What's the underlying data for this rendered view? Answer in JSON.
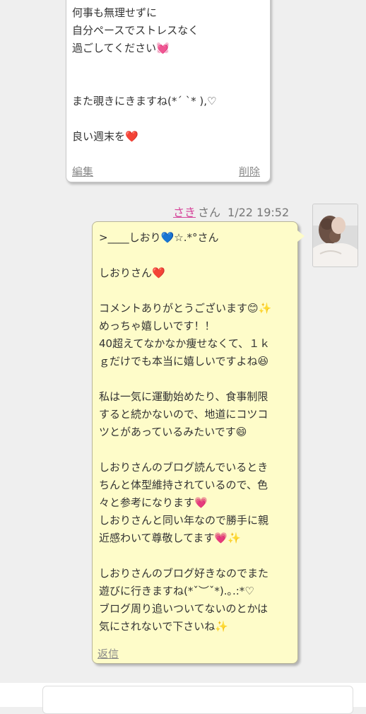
{
  "prev_comment": {
    "lines": [
      "何事も無理せずに",
      "自分ペースでストレスなく",
      "過ごしてください💓",
      "",
      "",
      "また覗きにきますね(*ˊ ˋ* ),♡",
      "",
      "良い週末を❤️"
    ],
    "edit_label": "編集",
    "delete_label": "削除"
  },
  "reply": {
    "author": "さき",
    "honorific": "さん",
    "timestamp": "1/22 19:52",
    "lines": [
      ">____しおり💙☆.*°さん",
      "",
      "しおりさん❤️",
      "",
      "コメントありがとうございます😊✨",
      "めっちゃ嬉しいです！！",
      "40超えてなかなか痩せなくて、１ｋ",
      "ｇだけでも本当に嬉しいですよね😆",
      "",
      "私は一気に運動始めたり、食事制限",
      "すると続かないので、地道にコツコ",
      "ツとがあっているみたいです😄",
      "",
      "しおりさんのブログ読んでいるとき",
      "ちんと体型維持されているので、色",
      "々と参考になります💗",
      "しおりさんと同い年なので勝手に親",
      "近感わいて尊敬してます💗✨",
      "",
      "しおりさんのブログ好きなのでまた",
      "遊びに行きますね(*ˇ︶ˇ*).｡.:*♡",
      "ブログ周り追いついてないのとかは",
      "気にされないで下さいね✨"
    ],
    "reply_label": "返信"
  }
}
